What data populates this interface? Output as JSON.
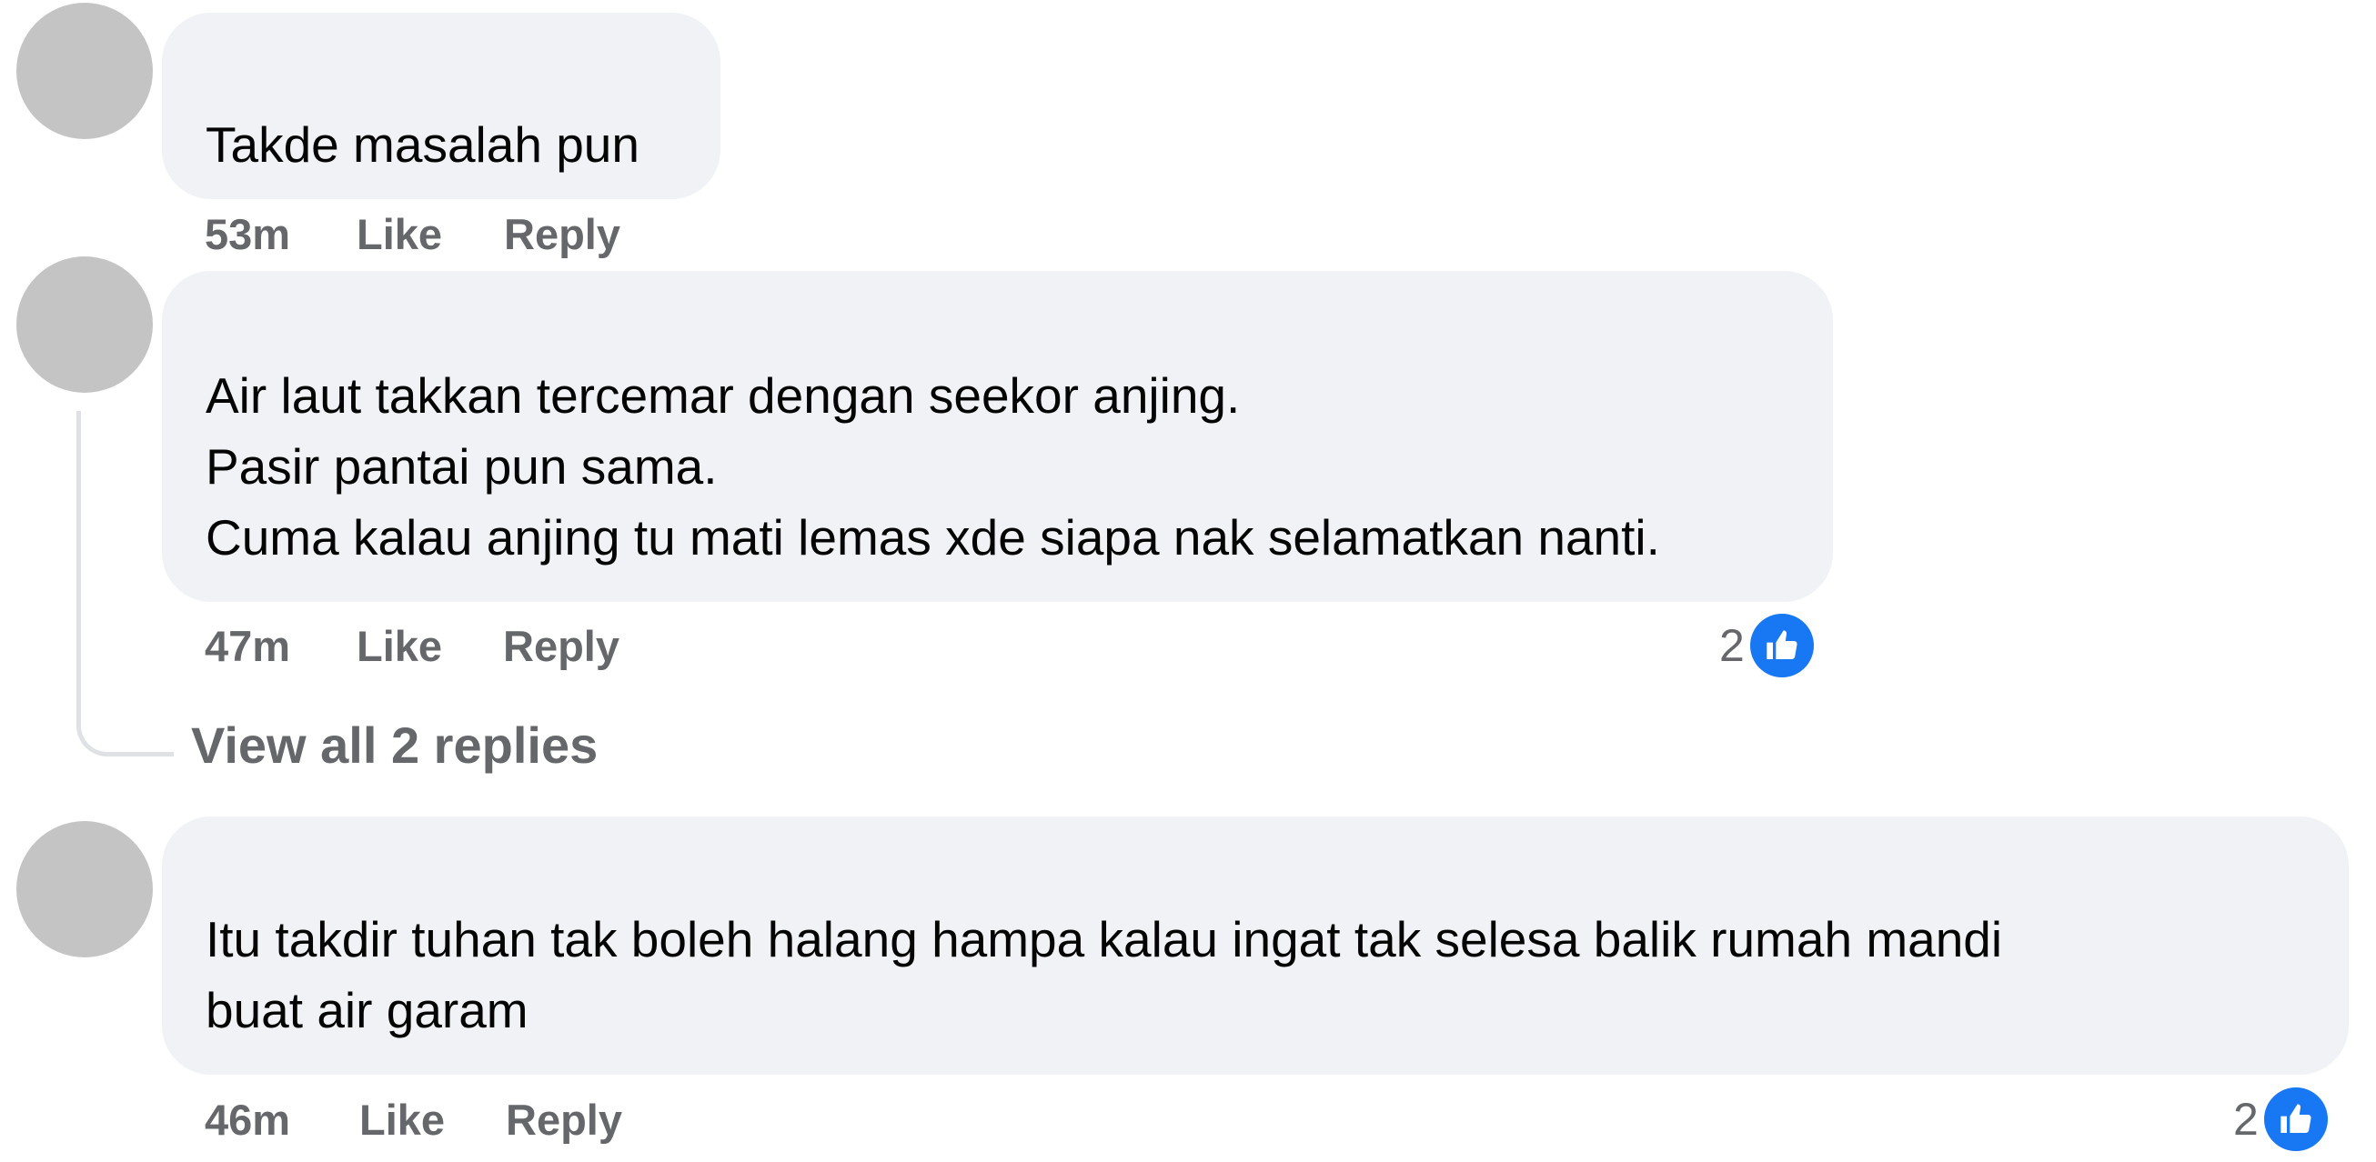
{
  "colors": {
    "avatar": "#c4c4c4",
    "bubble": "#f0f2f5",
    "meta_text": "#65676b",
    "like_blue": "#1877f2",
    "thread_line": "#dfe1e5"
  },
  "actions": {
    "like": "Like",
    "reply": "Reply"
  },
  "comments": [
    {
      "text": "Takde masalah pun",
      "time": "53m"
    },
    {
      "text": "Air laut takkan tercemar dengan seekor anjing.\nPasir pantai pun sama.\nCuma kalau anjing tu mati lemas xde siapa nak selamatkan nanti.",
      "time": "47m",
      "reaction_count": "2",
      "reaction_icon": "thumbs-up-icon",
      "view_replies": "View all 2 replies"
    },
    {
      "text": "Itu takdir tuhan tak boleh halang hampa kalau ingat tak selesa balik rumah mandi\nbuat air garam",
      "time": "46m",
      "reaction_count": "2",
      "reaction_icon": "thumbs-up-icon"
    }
  ]
}
